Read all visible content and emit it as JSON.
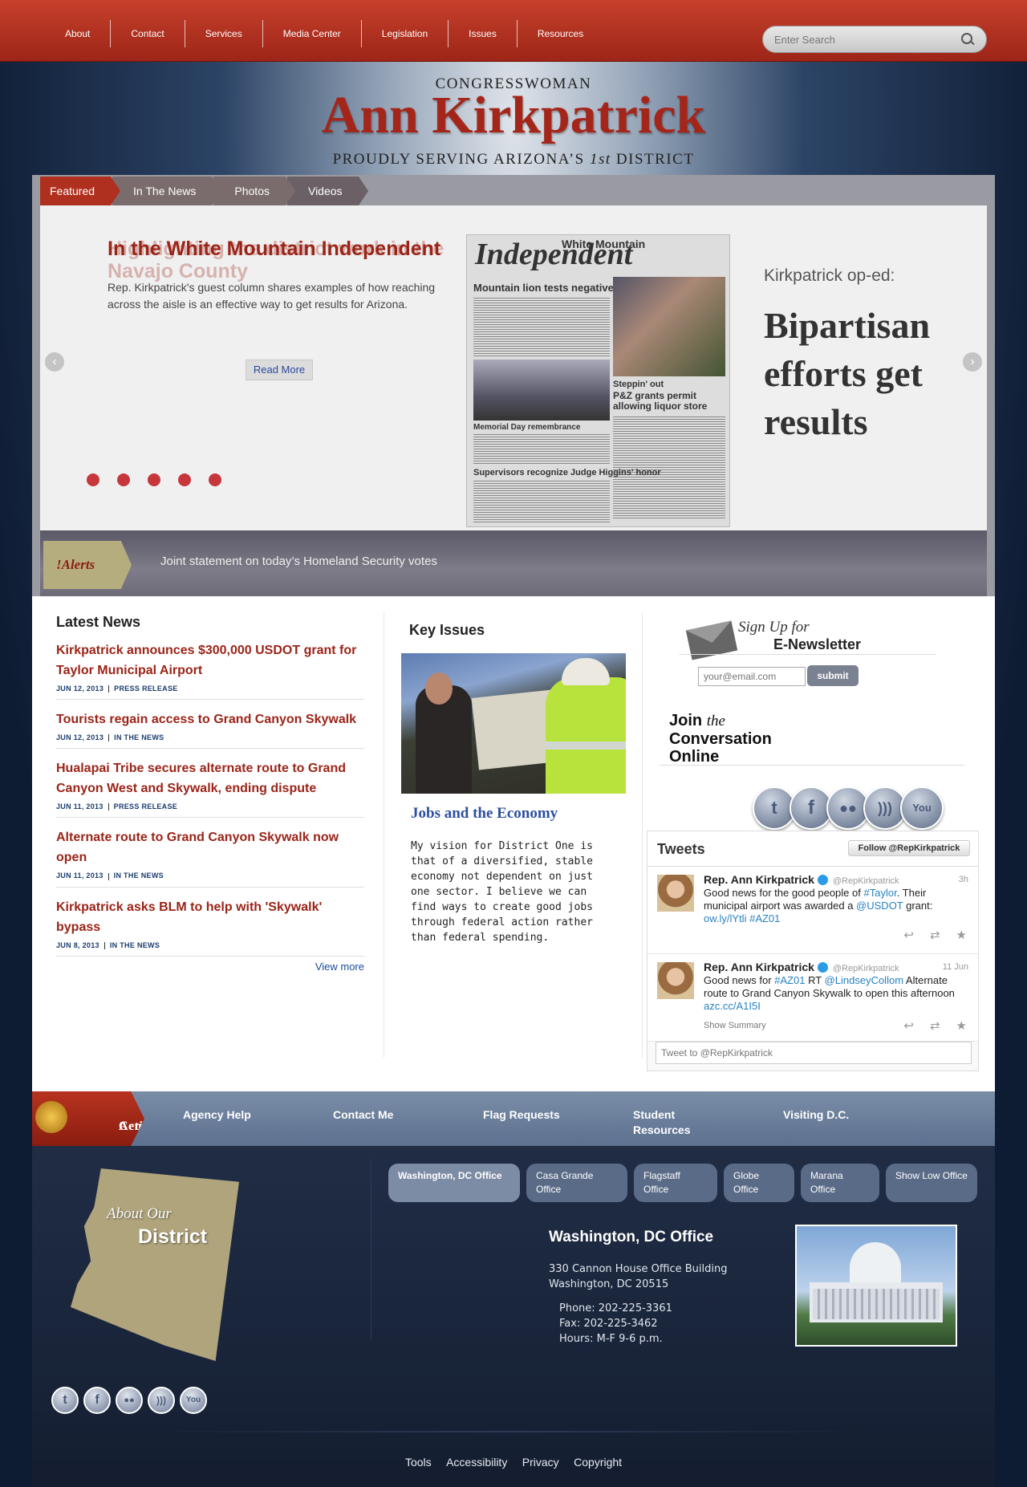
{
  "nav": {
    "items": [
      "About",
      "Contact",
      "Services",
      "Media Center",
      "Legislation",
      "Issues",
      "Resources"
    ],
    "search_placeholder": "Enter Search"
  },
  "header": {
    "line1": "CONGRESSWOMAN",
    "name": "Ann Kirkpatrick",
    "tagline_pre": "PROUDLY SERVING ARIZONA’S ",
    "tagline_em": "1st",
    "tagline_post": " DISTRICT"
  },
  "slider": {
    "tabs": [
      "Featured",
      "In The News",
      "Photos",
      "Videos"
    ],
    "title": "In the White Mountain Independent",
    "ghost_title": "Highlighting the district work in the Navajo County",
    "body": "Rep. Kirkpatrick's guest column shares examples of how reaching across the aisle is an effective way to get results for Arizona.",
    "read_more": "Read More",
    "prev": "‹",
    "next": "›",
    "slide_count": 5,
    "newspaper_name": "Independent",
    "newspaper_masthead": "White Mountain",
    "newspaper_heads": [
      "Mountain lion tests negative",
      "Steppin' out",
      "P&Z grants permit allowing liquor store",
      "Memorial Day remembrance",
      "Supervisors recognize Judge Higgins' honor"
    ],
    "oped_label": "Kirkpatrick op-ed:",
    "oped_title": "Bipartisan efforts get results"
  },
  "alerts": {
    "label": "!Alerts",
    "text": "Joint statement on today’s Homeland Security votes"
  },
  "latest_news": {
    "heading": "Latest News",
    "items": [
      {
        "title": "Kirkpatrick announces $300,000 USDOT grant for Taylor Municipal Airport",
        "date": "JUN 12, 2013",
        "type": "PRESS RELEASE"
      },
      {
        "title": "Tourists regain access to Grand Canyon Skywalk",
        "date": "JUN 12, 2013",
        "type": "IN THE NEWS"
      },
      {
        "title": "Hualapai Tribe secures alternate route to Grand Canyon West and Skywalk, ending dispute",
        "date": "JUN 11, 2013",
        "type": "PRESS RELEASE"
      },
      {
        "title": "Alternate route to Grand Canyon Skywalk now open",
        "date": "JUN 11, 2013",
        "type": "IN THE NEWS"
      },
      {
        "title": "Kirkpatrick asks BLM to help with 'Skywalk' bypass",
        "date": "JUN 8, 2013",
        "type": "IN THE NEWS"
      }
    ],
    "view_more": "View more"
  },
  "key_issues": {
    "heading": "Key Issues",
    "title": "Jobs and the Economy",
    "body": "My vision for District One is that of a diversified, stable economy not dependent on just one sector. I believe we can find ways to create good jobs through federal action rather than federal spending."
  },
  "newsletter": {
    "sign_up": "Sign Up for",
    "enews": "E-Newsletter",
    "email_placeholder": "your@email.com",
    "submit": "submit",
    "join_line1": "Join",
    "join_the": "the",
    "join_line2": "Conversation",
    "join_line3": "Online"
  },
  "social": [
    "twitter-icon",
    "facebook-icon",
    "flickr-icon",
    "rss-icon",
    "youtube-icon"
  ],
  "tweets": {
    "heading": "Tweets",
    "follow": "Follow @RepKirkpatrick",
    "items": [
      {
        "name": "Rep. Ann Kirkpatrick",
        "handle": "@RepKirkpatrick",
        "time": "3h",
        "text": "Good news for the good people of #Taylor. Their municipal airport was awarded a @USDOT grant: ow.ly/lYtli #AZ01",
        "summary": ""
      },
      {
        "name": "Rep. Ann Kirkpatrick",
        "handle": "@RepKirkpatrick",
        "time": "11 Jun",
        "text": "Good news for #AZ01 RT @LindseyCollom Alternate route to Grand Canyon Skywalk to open this afternoon azc.cc/A1I5I",
        "summary": "Show Summary"
      }
    ],
    "input_placeholder": "Tweet to @RepKirkpatrick"
  },
  "action_center": {
    "label_line1": "Action",
    "label_line2": "Center",
    "links": [
      "Agency Help",
      "Contact Me",
      "Flag Requests",
      "Student Resources",
      "Visiting D.C."
    ]
  },
  "district": {
    "about": "About Our",
    "district": "District"
  },
  "offices": {
    "tabs": [
      "Washington, DC Office",
      "Casa Grande Office",
      "Flagstaff Office",
      "Globe Office",
      "Marana Office",
      "Show Low Office"
    ],
    "title": "Washington, DC Office",
    "address1": "330 Cannon House Office Building",
    "address2": "Washington, DC 20515",
    "phone": "Phone: 202-225-3361",
    "fax": "Fax: 202-225-3462",
    "hours": "Hours: M-F 9-6 p.m."
  },
  "footer_links": [
    "Tools",
    "Accessibility",
    "Privacy",
    "Copyright"
  ],
  "colors": {
    "brand_red": "#a4261a",
    "nav_red": "#b7331f",
    "link_blue": "#2782c2",
    "footer_navy": "#182338"
  }
}
